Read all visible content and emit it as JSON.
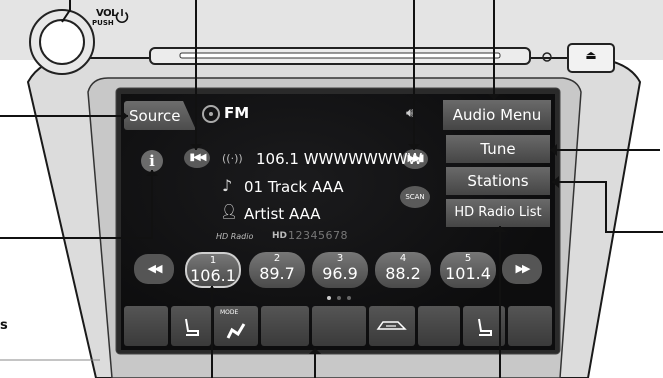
{
  "header": {
    "knob_vol_label": "VOL",
    "knob_push_label": "PUSH",
    "source_label": "Source",
    "band_label": "FM",
    "volume_icon": "speaker-icon",
    "audio_menu_label": "Audio Menu"
  },
  "right_menu": {
    "tune_label": "Tune",
    "stations_label": "Stations",
    "hd_radio_list_label": "HD Radio List"
  },
  "now_playing": {
    "station": "106.1 WWWWWWWW",
    "track": "01 Track AAA",
    "artist": "Artist AAA",
    "hd_radio_logo": "HD Radio",
    "hd_digits": "12345678",
    "scan_label": "SCAN"
  },
  "presets": [
    {
      "number": "1",
      "freq": "106.1"
    },
    {
      "number": "2",
      "freq": "89.7"
    },
    {
      "number": "3",
      "freq": "96.9"
    },
    {
      "number": "4",
      "freq": "88.2"
    },
    {
      "number": "5",
      "freq": "101.4"
    }
  ],
  "climate": {
    "mode_label": "MODE"
  },
  "side_text": "s",
  "colors": {
    "screen_bg": "#0f0f10",
    "button": "#5a5a5a",
    "bezel": "#d9d9d9"
  }
}
